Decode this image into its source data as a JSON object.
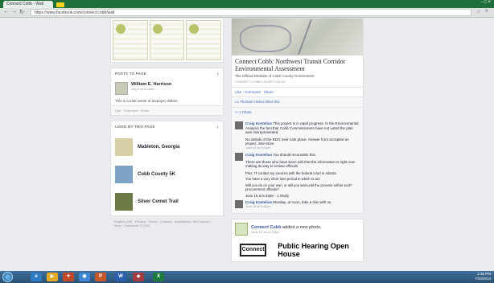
{
  "browser": {
    "tab_title": "Connect Cobb - Wall",
    "url": "https://www.facebook.com/connect.cobb/wall",
    "controls": "- □ ×"
  },
  "left": {
    "posts_header": "POSTS TO PAGE",
    "post": {
      "author": "William E. Harrison",
      "time": "July 9 at 9:08am",
      "text": "This is a total waste of taxpayer dollars.",
      "actions": "Like · Comment · Share"
    },
    "liked_header": "LIKED BY THIS PAGE",
    "liked": [
      {
        "name": "Mableton, Georgia",
        "color": "#d9cfa6"
      },
      {
        "name": "Cobb County 5K",
        "color": "#7fa3c5"
      },
      {
        "name": "Silver Comet Trail",
        "color": "#6c7b45"
      }
    ],
    "footer": "English (US) · Privacy · Terms · Cookies · Advertising · Ad Choices · More · Facebook © 2013"
  },
  "right": {
    "link_title": "Connect Cobb: Northwest Transit Corridor Environmental Assessment",
    "link_sub": "The Official Website of Cobb County Government",
    "link_url": "CONNECT.COBB.COUNTY.GA.US",
    "actions": "Like · Comment · Share",
    "likes": "Thomas Hickox likes this.",
    "shares": "1 Share",
    "comments": [
      {
        "author": "Craig Kostelius",
        "text": "This project is in rapid progress. In the Environmental Analysis the fact that Cobb Commissioners have not voted the plan was misrepresented.",
        "extra": "No details of the BOG ever took place. Answer from accepted as project. See More",
        "meta": "June 16 at 5:41pm"
      },
      {
        "author": "Craig Kostelius",
        "text": "You should reconsider this.",
        "extra": "There are those who have been told that the information is right now making its way to review officials.",
        "meta": "June 16 at 5:41pm"
      },
      {
        "author": "Craig Kostelius",
        "text": "Monday, at noon, take a ride with us.",
        "extra": "",
        "meta": "June 16 at 5:42pm"
      }
    ],
    "paras": [
      "Plus, IT contact my sources with the federal court in Atlanta.",
      "You have a very short time period in which to act.",
      "Will you do on your own, or will you wait until the process will be end? procurement officials?",
      "June 16 at 5:43pm · 1 Reply"
    ],
    "post2": {
      "page": "Connect Cobb",
      "action": "added a new photo.",
      "time": "June 13 at 12:03pm",
      "logo_text": "Connect",
      "banner": "Public Hearing Open House"
    }
  },
  "taskbar": {
    "time": "1:35 PM",
    "date": "7/10/2013",
    "apps": [
      {
        "label": "IE",
        "color": "#2e7bc4"
      },
      {
        "label": "▶",
        "color": "#e3a825"
      },
      {
        "label": "✦",
        "color": "#c24a2a"
      },
      {
        "label": "◉",
        "color": "#3e87d3"
      },
      {
        "label": "P",
        "color": "#c8582c"
      },
      {
        "label": "W",
        "color": "#2b5fb0"
      },
      {
        "label": "◈",
        "color": "#a33c3c"
      },
      {
        "label": "X",
        "color": "#1e7a3c"
      }
    ]
  }
}
